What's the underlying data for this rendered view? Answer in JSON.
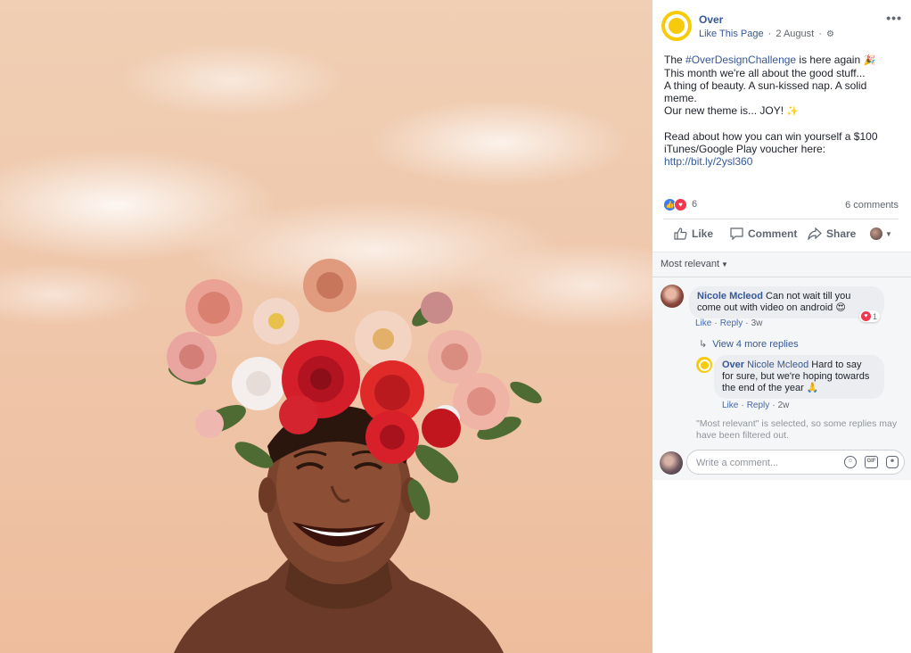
{
  "post": {
    "page_name": "Over",
    "like_page": "Like This Page",
    "date": "2 August",
    "text": {
      "line1_pre": "The ",
      "hashtag": "#OverDesignChallenge",
      "line1_post": " is here again ",
      "line2": "This month we're all about the good stuff...",
      "line3": "A thing of beauty. A sun-kissed nap. A solid",
      "line4": "meme.",
      "line5": "Our new theme is... JOY! ",
      "line6": "Read about how you can win yourself a $100",
      "line7": "iTunes/Google Play voucher here:",
      "link": "http://bit.ly/2ysl360"
    },
    "emoji": {
      "party": "🎉",
      "sparkles": "✨"
    },
    "reaction_count": "6",
    "comments_count": "6 comments",
    "actions": {
      "like": "Like",
      "comment": "Comment",
      "share": "Share"
    }
  },
  "comments": {
    "sort_label": "Most relevant",
    "items": [
      {
        "author": "Nicole Mcleod",
        "text_part1": "Can not wait till you",
        "text_part2": "come out with video on android ",
        "emoji": "😍",
        "reaction_count": "1",
        "like": "Like",
        "reply": "Reply",
        "time": "3w"
      }
    ],
    "more_replies": "View 4 more replies",
    "reply": {
      "author": "Over",
      "mention": "Nicole Mcleod",
      "text_part1": "Hard to say",
      "text_part2": "for sure, but we're hoping towards",
      "text_part3": "the end of the year ",
      "emoji": "🙏",
      "like": "Like",
      "reply": "Reply",
      "time": "2w"
    },
    "filter_note": "\"Most relevant\" is selected, so some replies may have been filtered out.",
    "write_placeholder": "Write a comment..."
  },
  "colors": {
    "brand_yellow": "#f7ca0a",
    "link_blue": "#365899",
    "like_blue": "#3b7ded",
    "love_red": "#f0384f",
    "photo_background": "#efc7ab"
  }
}
